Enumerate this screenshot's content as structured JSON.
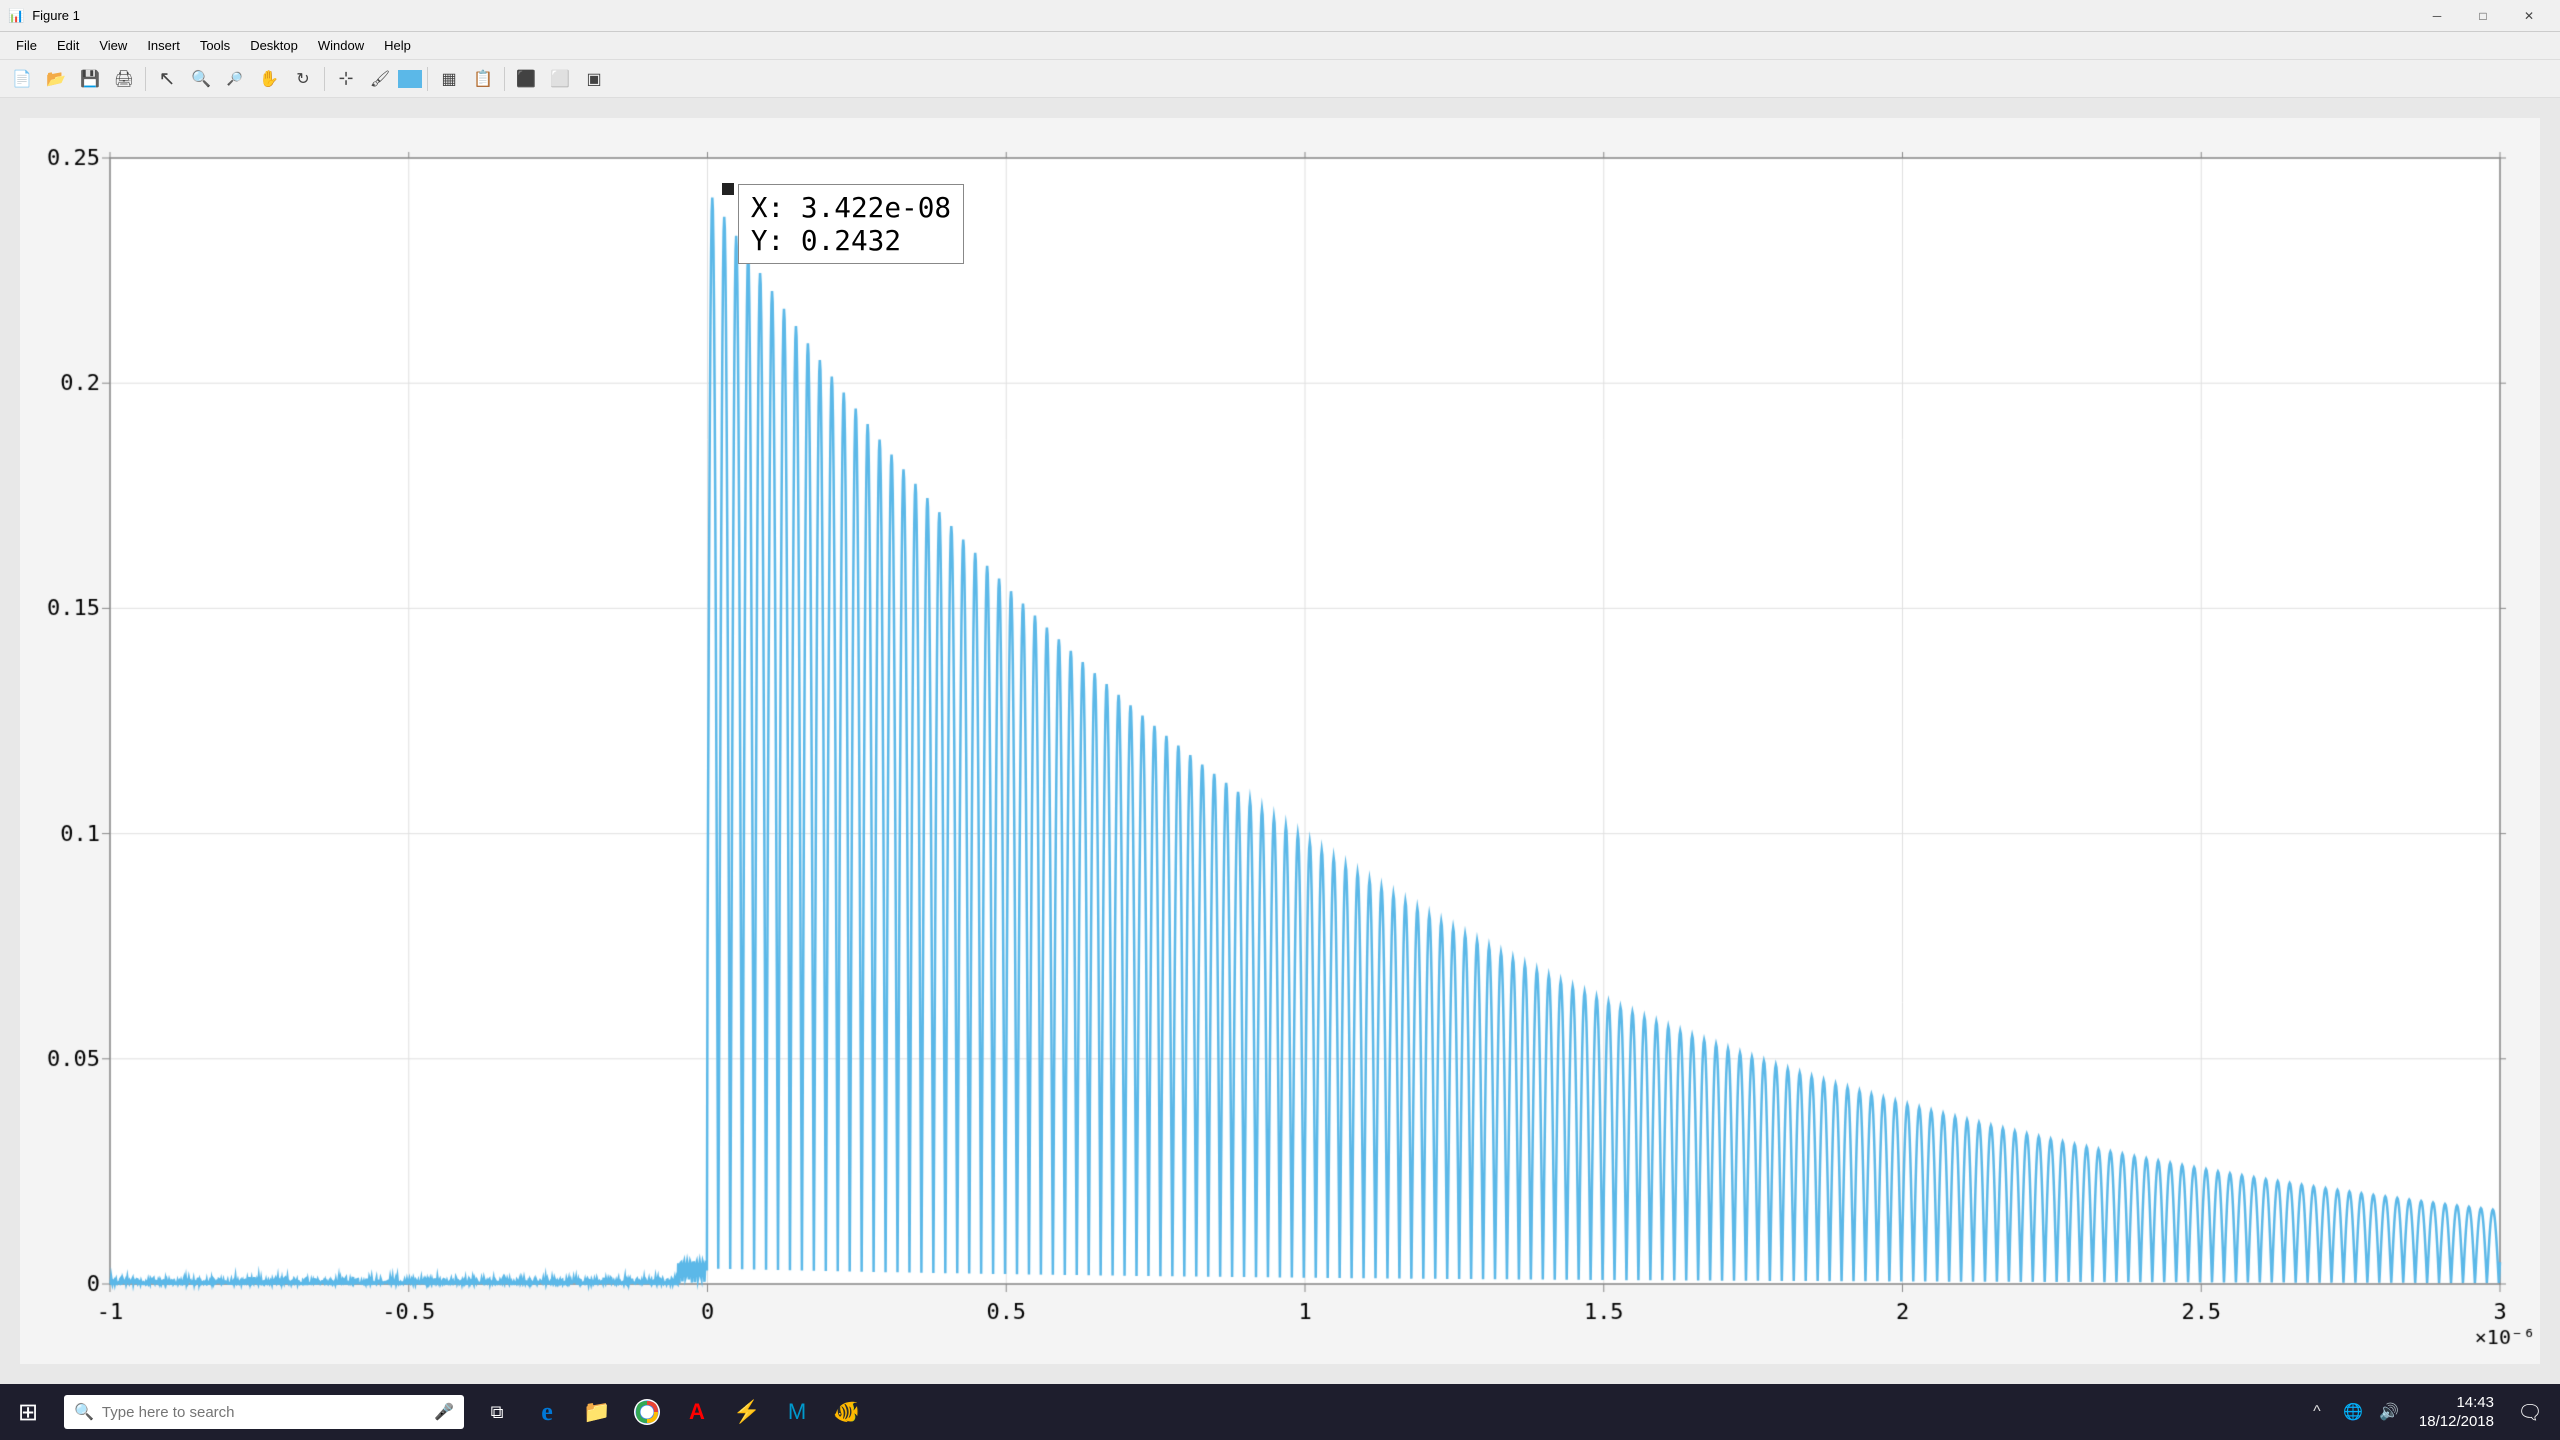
{
  "titlebar": {
    "title": "Figure 1",
    "icon": "📊",
    "minimize_label": "─",
    "maximize_label": "□",
    "close_label": "✕"
  },
  "menubar": {
    "items": [
      "File",
      "Edit",
      "View",
      "Insert",
      "Tools",
      "Desktop",
      "Window",
      "Help"
    ]
  },
  "toolbar": {
    "buttons": [
      {
        "name": "new-figure",
        "icon": "📄"
      },
      {
        "name": "open-file",
        "icon": "📂"
      },
      {
        "name": "save",
        "icon": "💾"
      },
      {
        "name": "print",
        "icon": "🖨"
      },
      {
        "name": "select",
        "icon": "↖"
      },
      {
        "name": "zoom-in",
        "icon": "🔍"
      },
      {
        "name": "zoom-out",
        "icon": "🔎"
      },
      {
        "name": "pan",
        "icon": "✋"
      },
      {
        "name": "rotate",
        "icon": "↻"
      },
      {
        "name": "data-cursor",
        "icon": "✚"
      },
      {
        "name": "brush",
        "icon": "🖌"
      },
      {
        "name": "color-picker",
        "icon": "🎨"
      },
      {
        "name": "insert-colorbar",
        "icon": "▦"
      },
      {
        "name": "insert-legend",
        "icon": "📋"
      },
      {
        "name": "hide-plot",
        "icon": "⬛"
      },
      {
        "name": "subplot",
        "icon": "⬜"
      },
      {
        "name": "tight-layout",
        "icon": "⬜"
      }
    ]
  },
  "plot": {
    "y_axis": {
      "labels": [
        "0",
        "0.05",
        "0.1",
        "0.15",
        "0.2",
        "0.25"
      ],
      "min": 0,
      "max": 0.25
    },
    "x_axis": {
      "labels": [
        "-1",
        "-0.5",
        "0",
        "0.5",
        "1",
        "1.5",
        "2",
        "2.5",
        "3"
      ],
      "scale_label": "×10⁻⁶",
      "min": -1,
      "max": 3
    },
    "tooltip": {
      "x_label": "X: 3.422e-08",
      "y_label": "Y: 0.2432"
    },
    "line_color": "#5BB8E8"
  },
  "taskbar": {
    "start_icon": "⊞",
    "search_placeholder": "Type here to search",
    "search_mic_icon": "🎤",
    "task_view_icon": "⧉",
    "apps": [
      {
        "name": "task-view",
        "icon": "⧉"
      },
      {
        "name": "edge",
        "icon": "e"
      },
      {
        "name": "explorer",
        "icon": "📁"
      },
      {
        "name": "chrome",
        "icon": "⬤"
      },
      {
        "name": "acrobat",
        "icon": "A"
      },
      {
        "name": "app1",
        "icon": "⚡"
      },
      {
        "name": "matlab",
        "icon": "M"
      },
      {
        "name": "app2",
        "icon": "🐠"
      }
    ],
    "system_tray": {
      "chevron": "^",
      "network": "🌐",
      "volume": "🔊",
      "time": "14:43",
      "date": "18/12/2018",
      "notification": "🗨"
    }
  }
}
